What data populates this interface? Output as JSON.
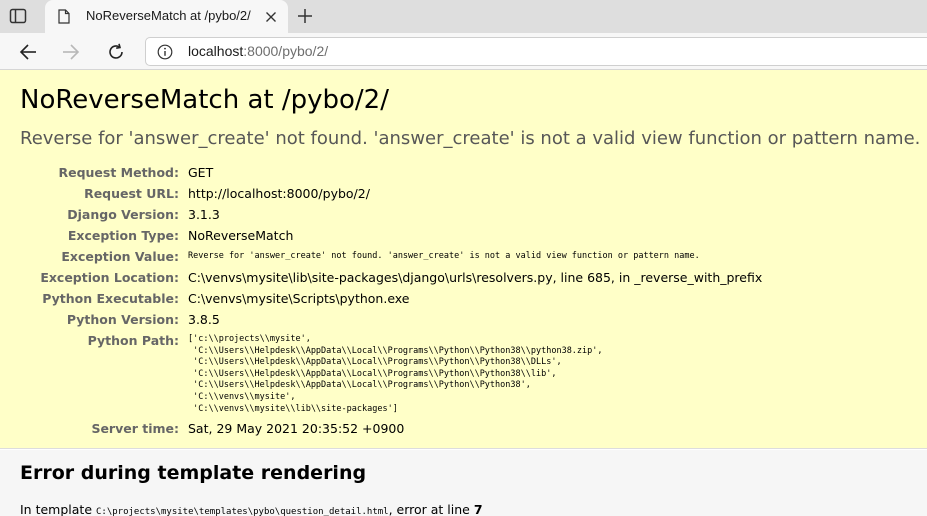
{
  "browser": {
    "tab_title": "NoReverseMatch at /pybo/2/",
    "url_host": "localhost",
    "url_rest": ":8000/pybo/2/"
  },
  "page": {
    "title": "NoReverseMatch at /pybo/2/",
    "subtitle": "Reverse for 'answer_create' not found. 'answer_create' is not a valid view function or pattern name.",
    "meta": [
      {
        "key": "Request Method:",
        "value": "GET"
      },
      {
        "key": "Request URL:",
        "value": "http://localhost:8000/pybo/2/"
      },
      {
        "key": "Django Version:",
        "value": "3.1.3"
      },
      {
        "key": "Exception Type:",
        "value": "NoReverseMatch"
      },
      {
        "key": "Exception Value:",
        "value": "Reverse for 'answer_create' not found. 'answer_create' is not a valid view function or pattern name."
      },
      {
        "key": "Exception Location:",
        "value": "C:\\venvs\\mysite\\lib\\site-packages\\django\\urls\\resolvers.py, line 685, in _reverse_with_prefix"
      },
      {
        "key": "Python Executable:",
        "value": "C:\\venvs\\mysite\\Scripts\\python.exe"
      },
      {
        "key": "Python Version:",
        "value": "3.8.5"
      },
      {
        "key": "Python Path:",
        "value": "['c:\\\\projects\\\\mysite',\n 'C:\\\\Users\\\\Helpdesk\\\\AppData\\\\Local\\\\Programs\\\\Python\\\\Python38\\\\python38.zip',\n 'C:\\\\Users\\\\Helpdesk\\\\AppData\\\\Local\\\\Programs\\\\Python\\\\Python38\\\\DLLs',\n 'C:\\\\Users\\\\Helpdesk\\\\AppData\\\\Local\\\\Programs\\\\Python\\\\Python38\\\\lib',\n 'C:\\\\Users\\\\Helpdesk\\\\AppData\\\\Local\\\\Programs\\\\Python\\\\Python38',\n 'C:\\\\venvs\\\\mysite',\n 'C:\\\\venvs\\\\mysite\\\\lib\\\\site-packages']"
      },
      {
        "key": "Server time:",
        "value": "Sat, 29 May 2021 20:35:52 +0900"
      }
    ],
    "template_section": {
      "title": "Error during template rendering",
      "prefix": "In template ",
      "path": "C:\\projects\\mysite\\templates\\pybo\\question_detail.html",
      "middle": ", error at line ",
      "line": "7"
    }
  },
  "icons": {
    "tab_actions": "tab-actions-icon",
    "favicon": "page-icon",
    "close": "close-icon",
    "new_tab": "plus-icon",
    "back": "arrow-left-icon",
    "forward": "arrow-right-icon",
    "refresh": "refresh-icon",
    "info": "info-icon"
  }
}
